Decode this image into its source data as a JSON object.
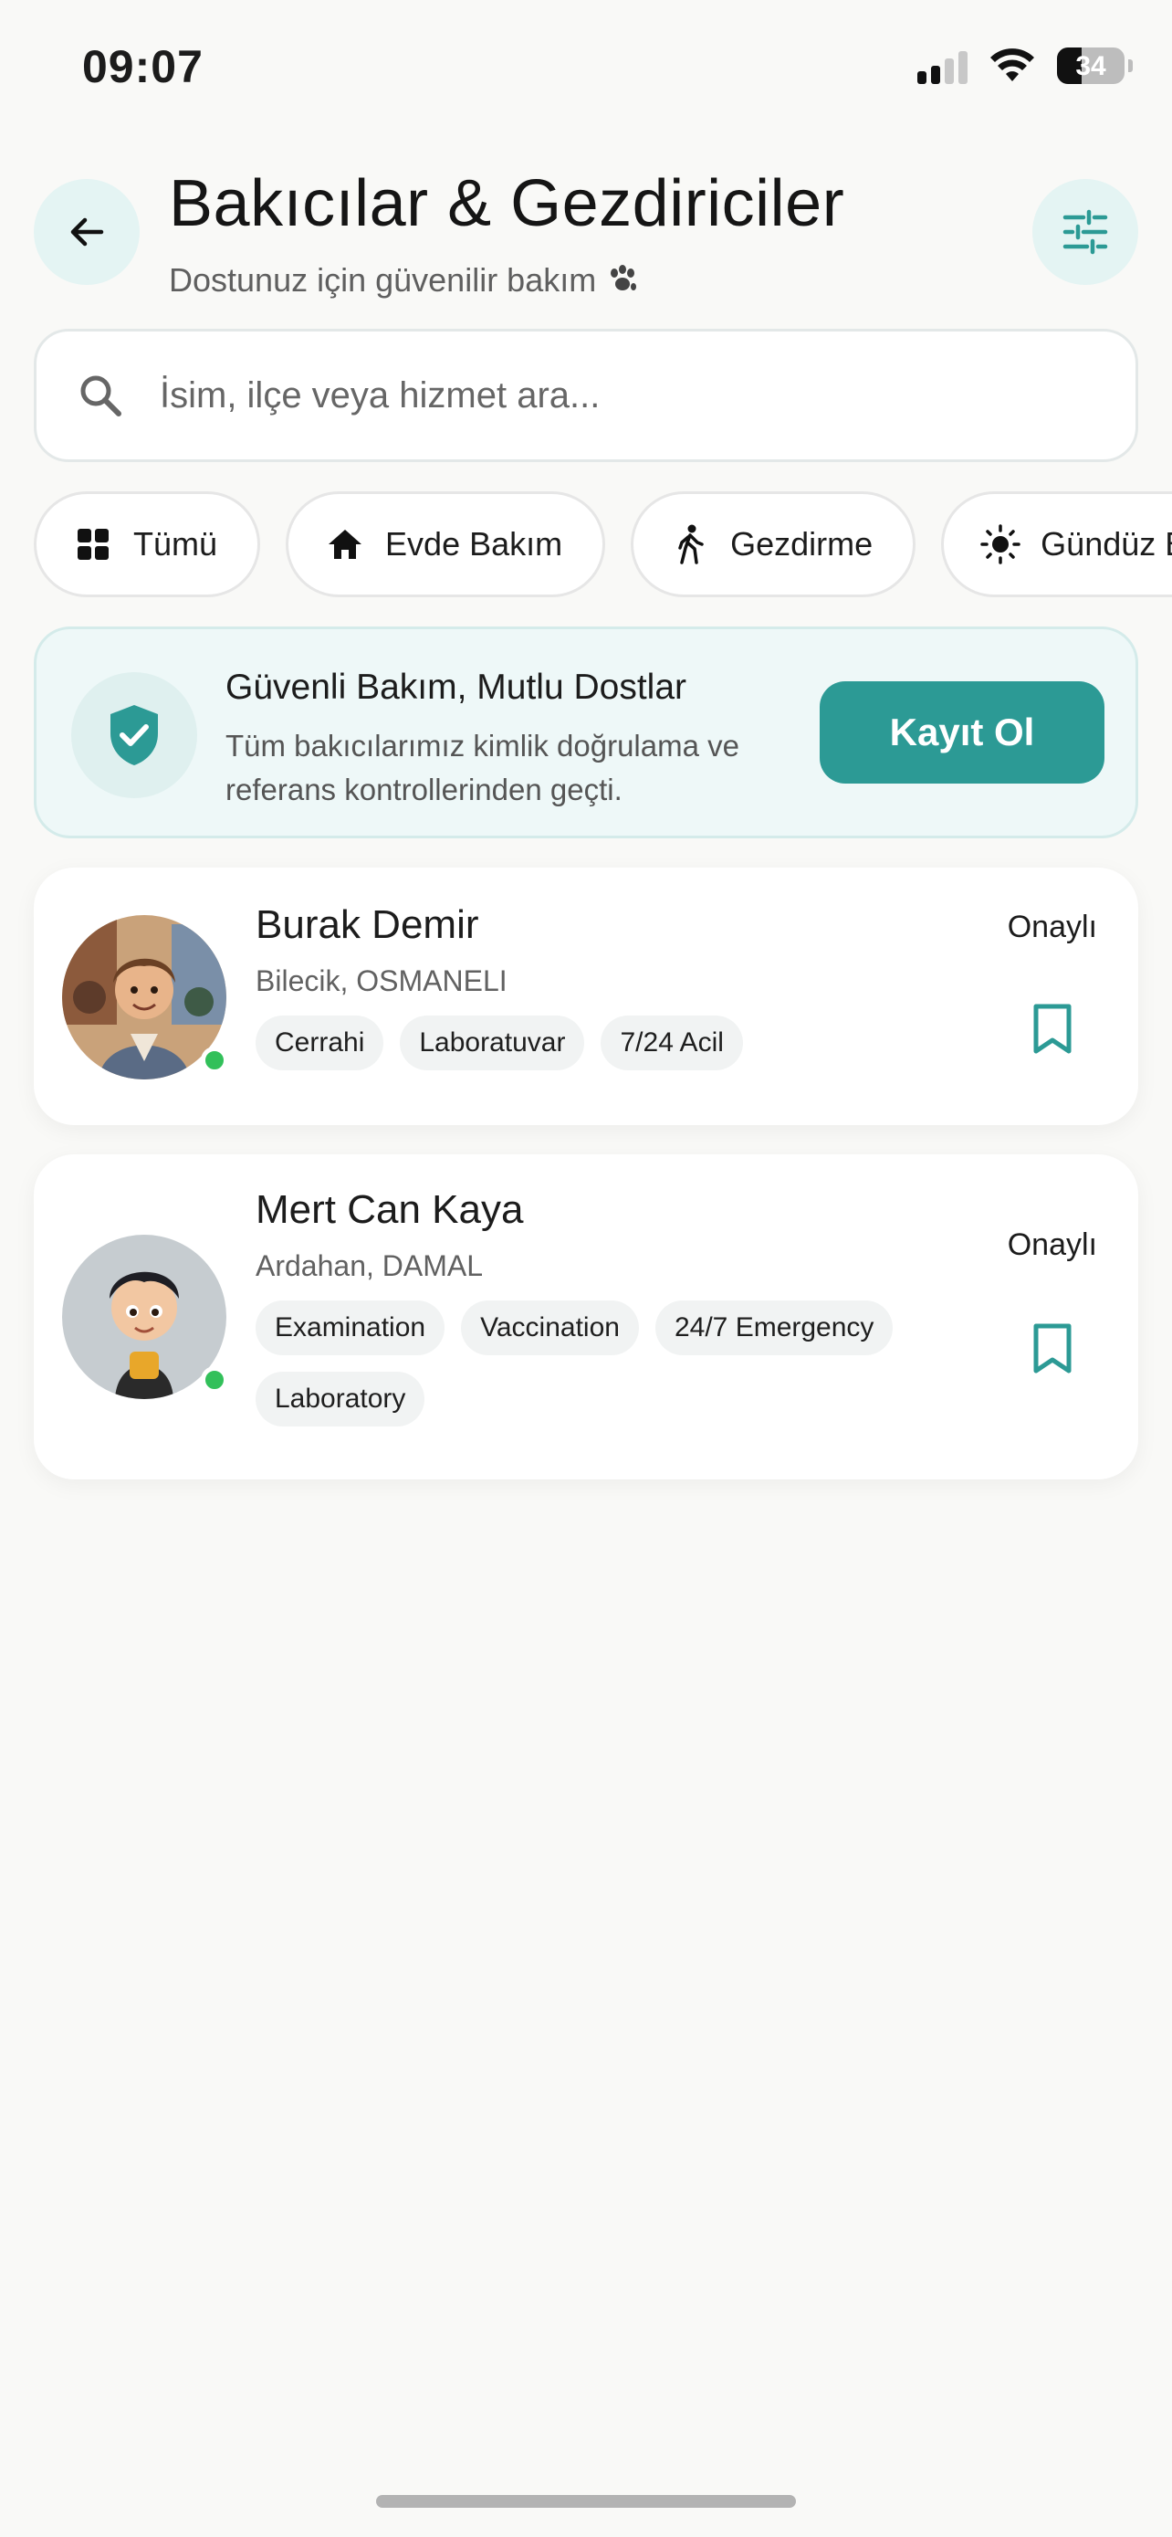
{
  "status_bar": {
    "time": "09:07",
    "battery": "34"
  },
  "header": {
    "title": "Bakıcılar & Gezdiriciler",
    "subtitle": "Dostunuz için güvenilir bakım",
    "subtitle_icon": "paw-icon",
    "back_icon": "arrow-left-icon",
    "filter_icon": "sliders-icon"
  },
  "search": {
    "placeholder": "İsim, ilçe veya hizmet ara...",
    "value": "",
    "icon": "search-icon"
  },
  "chips": [
    {
      "label": "Tümü",
      "icon": "grid-icon"
    },
    {
      "label": "Evde Bakım",
      "icon": "home-icon"
    },
    {
      "label": "Gezdirme",
      "icon": "walking-icon"
    },
    {
      "label": "Gündüz Ba",
      "icon": "sun-icon"
    }
  ],
  "banner": {
    "title": "Güvenli Bakım, Mutlu Dostlar",
    "text": "Tüm bakıcılarımız kimlik doğrulama ve referans kontrollerinden geçti.",
    "button_label": "Kayıt Ol",
    "icon": "shield-check-icon"
  },
  "caregivers": [
    {
      "name": "Burak Demir",
      "location": "Bilecik, OSMANELI",
      "tags": [
        "Cerrahi",
        "Laboratuvar",
        "7/24 Acil"
      ],
      "status": "Onaylı",
      "online": true
    },
    {
      "name": "Mert Can Kaya",
      "location": "Ardahan, DAMAL",
      "tags": [
        "Examination",
        "Vaccination",
        "24/7 Emergency",
        "Laboratory"
      ],
      "status": "Onaylı",
      "online": true
    }
  ],
  "colors": {
    "accent": "#2c9a95",
    "accent_light": "#e4f4f3",
    "online": "#32c05a",
    "background": "#f9f9f7"
  }
}
